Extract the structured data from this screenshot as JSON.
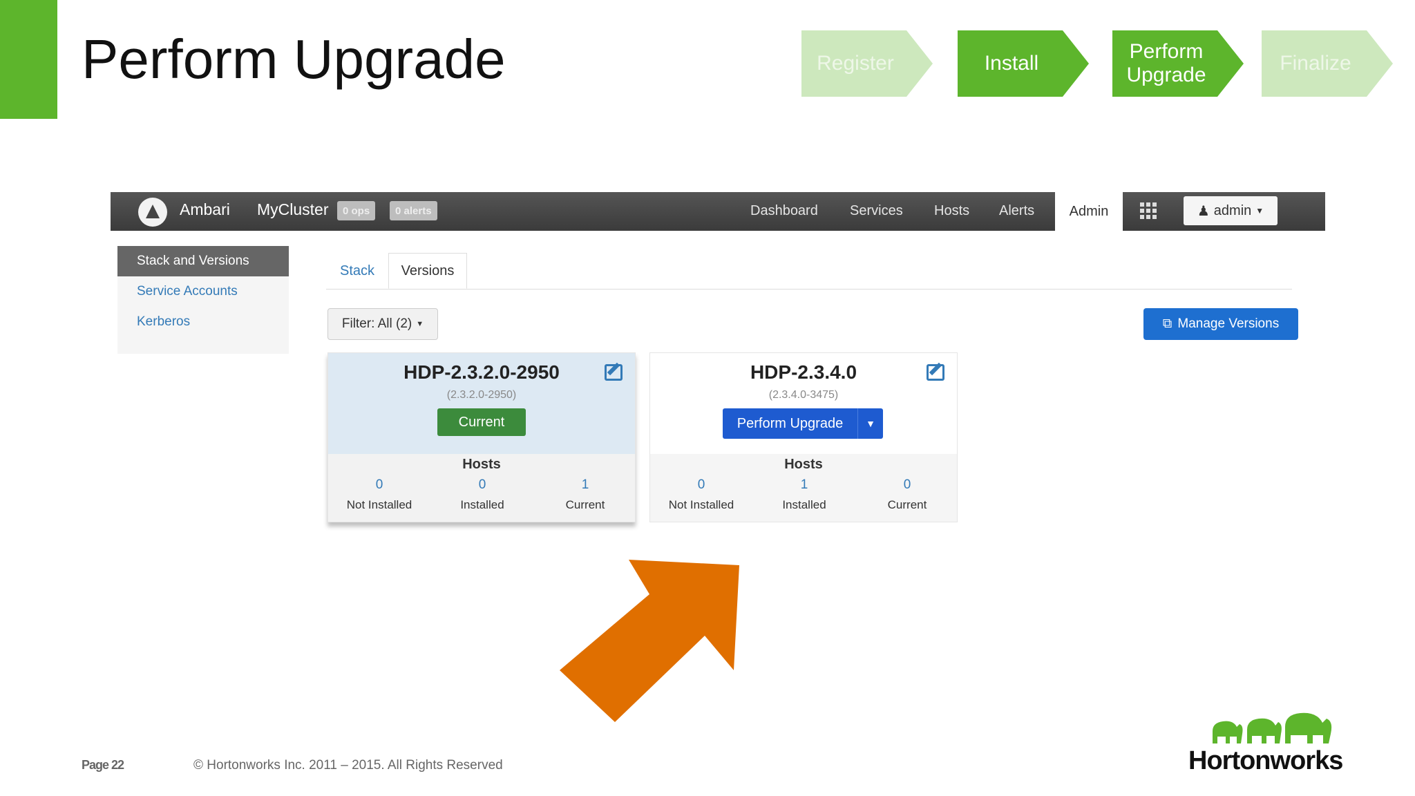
{
  "slide": {
    "title": "Perform Upgrade",
    "steps": [
      {
        "label": "Register",
        "state": "inactive"
      },
      {
        "label": "Install",
        "state": "done"
      },
      {
        "label": "Perform Upgrade",
        "state": "active"
      },
      {
        "label": "Finalize",
        "state": "inactive"
      }
    ],
    "page_label": "Page 22",
    "copyright": "© Hortonworks Inc. 2011 – 2015. All Rights Reserved",
    "brand": "Hortonworks",
    "colors": {
      "green": "#5db52c",
      "light_green": "#cde8bd",
      "arrow": "#e06f00"
    }
  },
  "ambari": {
    "navbar": {
      "brand": "Ambari",
      "cluster": "MyCluster",
      "ops_badge": "0 ops",
      "alerts_badge": "0 alerts",
      "links": [
        "Dashboard",
        "Services",
        "Hosts",
        "Alerts"
      ],
      "admin_tab": "Admin",
      "user": "admin"
    },
    "sidebar": {
      "items": [
        {
          "label": "Stack and Versions",
          "active": true
        },
        {
          "label": "Service Accounts",
          "active": false
        },
        {
          "label": "Kerberos",
          "active": false
        }
      ]
    },
    "tabs": {
      "stack": "Stack",
      "versions": "Versions"
    },
    "filter_label": "Filter: All (2)",
    "manage_versions": "Manage Versions",
    "hosts_label": "Hosts",
    "host_labels": [
      "Not Installed",
      "Installed",
      "Current"
    ],
    "cards": [
      {
        "name": "HDP-2.3.2.0-2950",
        "version": "(2.3.2.0-2950)",
        "button": "Current",
        "hosts": {
          "not_installed": "0",
          "installed": "0",
          "current": "1"
        }
      },
      {
        "name": "HDP-2.3.4.0",
        "version": "(2.3.4.0-3475)",
        "button": "Perform Upgrade",
        "hosts": {
          "not_installed": "0",
          "installed": "1",
          "current": "0"
        }
      }
    ]
  }
}
